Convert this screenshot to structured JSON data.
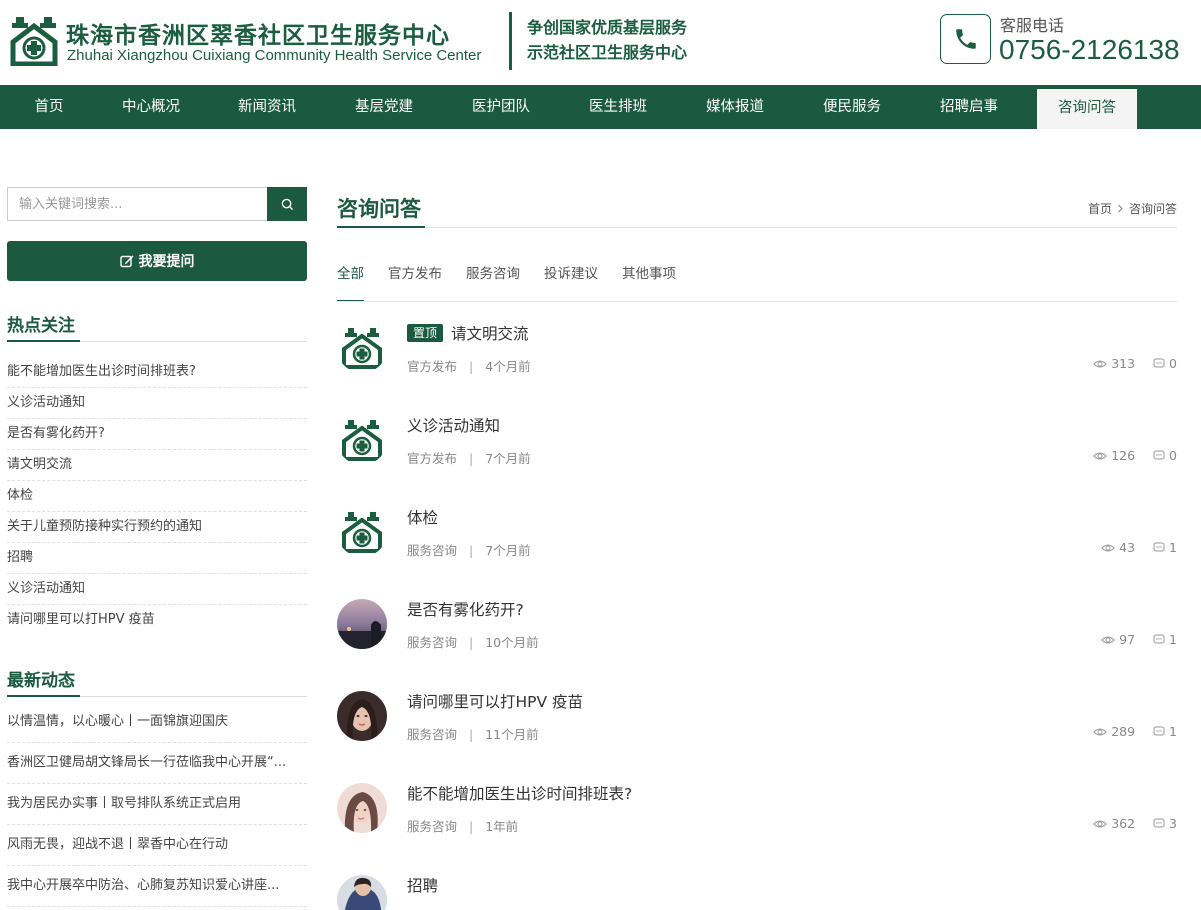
{
  "header": {
    "title_cn": "珠海市香洲区翠香社区卫生服务中心",
    "title_en": "Zhuhai Xiangzhou Cuixiang Community Health Service Center",
    "slogan_line1": "争创国家优质基层服务",
    "slogan_line2": "示范社区卫生服务中心",
    "phone_label": "客服电话",
    "phone_number": "0756-2126138",
    "brand_color": "#1b5a40"
  },
  "nav": {
    "items": [
      {
        "label": "首页"
      },
      {
        "label": "中心概况"
      },
      {
        "label": "新闻资讯"
      },
      {
        "label": "基层党建"
      },
      {
        "label": "医护团队"
      },
      {
        "label": "医生排班"
      },
      {
        "label": "媒体报道"
      },
      {
        "label": "便民服务"
      },
      {
        "label": "招聘启事"
      },
      {
        "label": "咨询问答"
      }
    ],
    "active": "咨询问答"
  },
  "sidebar": {
    "search_placeholder": "输入关键词搜索...",
    "ask_button": "我要提问",
    "hot_title": "热点关注",
    "hot_items": [
      "能不能增加医生出诊时间排班表?",
      "义诊活动通知",
      "是否有雾化药开?",
      "请文明交流",
      "体检",
      "关于儿童预防接种实行预约的通知",
      "招聘",
      "义诊活动通知",
      "请问哪里可以打HPV 疫苗"
    ],
    "news_title": "最新动态",
    "news_items": [
      "以情温情，以心暖心丨一面锦旗迎国庆",
      "香洲区卫健局胡文锋局长一行莅临我中心开展“...",
      "我为居民办实事丨取号排队系统正式启用",
      "风雨无畏，迎战不退丨翠香中心在行动",
      "我中心开展卒中防治、心肺复苏知识爱心讲座..."
    ]
  },
  "main": {
    "title": "咨询问答",
    "breadcrumb": [
      "首页",
      "咨询问答"
    ],
    "tabs": [
      "全部",
      "官方发布",
      "服务咨询",
      "投诉建议",
      "其他事项"
    ],
    "active_tab": "全部",
    "pin_label": "置顶",
    "questions": [
      {
        "title": "请文明交流",
        "pinned": true,
        "category": "官方发布",
        "time": "4个月前",
        "views": "313",
        "comments": "0",
        "avatar": "logo-icon"
      },
      {
        "title": "义诊活动通知",
        "pinned": false,
        "category": "官方发布",
        "time": "7个月前",
        "views": "126",
        "comments": "0",
        "avatar": "logo-icon"
      },
      {
        "title": "体检",
        "pinned": false,
        "category": "服务咨询",
        "time": "7个月前",
        "views": "43",
        "comments": "1",
        "avatar": "logo-icon"
      },
      {
        "title": "是否有雾化药开?",
        "pinned": false,
        "category": "服务咨询",
        "time": "10个月前",
        "views": "97",
        "comments": "1",
        "avatar": "user-photo"
      },
      {
        "title": "请问哪里可以打HPV 疫苗",
        "pinned": false,
        "category": "服务咨询",
        "time": "11个月前",
        "views": "289",
        "comments": "1",
        "avatar": "user-photo"
      },
      {
        "title": "能不能增加医生出诊时间排班表?",
        "pinned": false,
        "category": "服务咨询",
        "time": "1年前",
        "views": "362",
        "comments": "3",
        "avatar": "user-photo"
      },
      {
        "title": "招聘",
        "pinned": false,
        "category": "",
        "time": "",
        "views": "",
        "comments": "",
        "avatar": "user-photo"
      }
    ]
  }
}
